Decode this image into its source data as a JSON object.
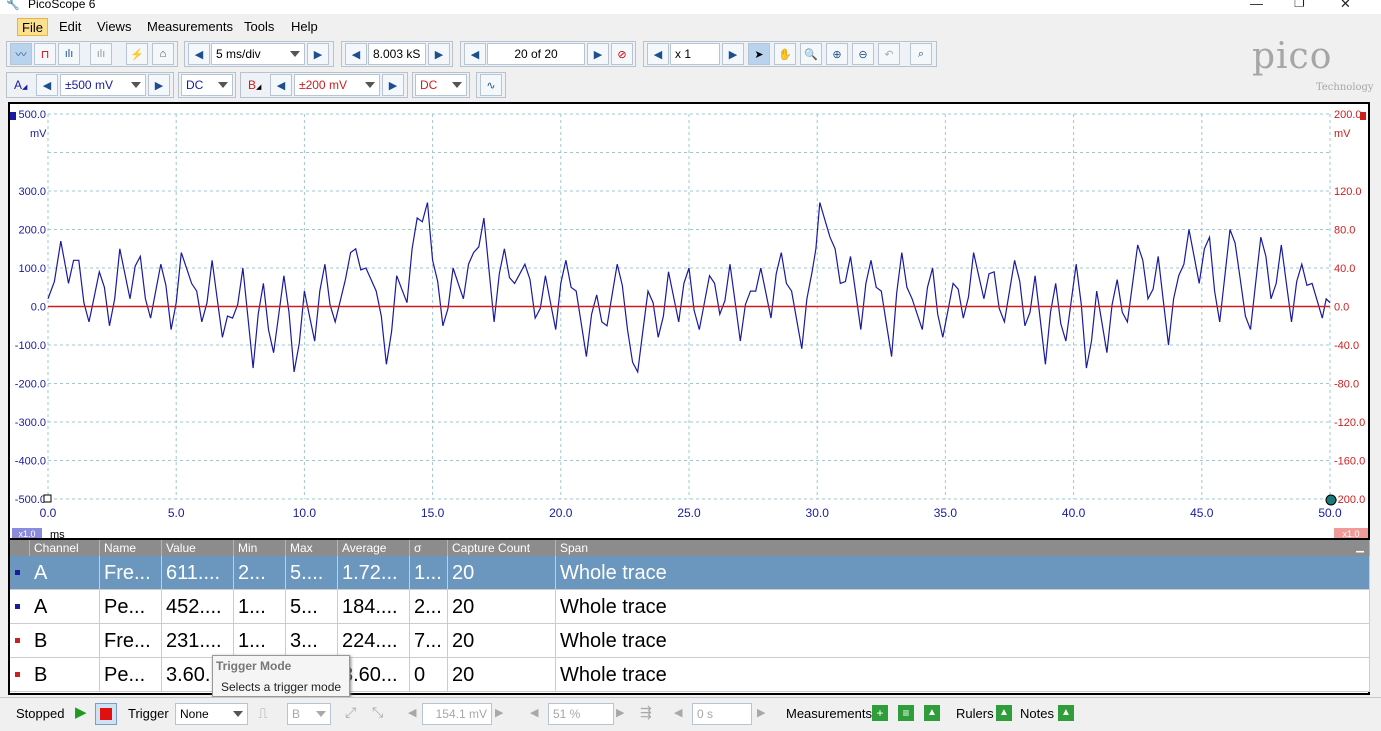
{
  "window": {
    "title": "PicoScope 6"
  },
  "menu": [
    "File",
    "Edit",
    "Views",
    "Measurements",
    "Tools",
    "Help"
  ],
  "toolbar": {
    "timebase": "5 ms/div",
    "samples": "8.003 kS",
    "buffer": "20 of 20",
    "zoom": "x 1"
  },
  "channels": {
    "a": {
      "label": "A",
      "range": "±500 mV",
      "coupling": "DC"
    },
    "b": {
      "label": "B",
      "range": "±200 mV",
      "coupling": "DC"
    }
  },
  "logo": {
    "brand": "pico",
    "sub": "Technology"
  },
  "plot": {
    "left_axis": [
      "500.0",
      "300.0",
      "200.0",
      "100.0",
      "0.0",
      "-100.0",
      "-200.0",
      "-300.0",
      "-400.0",
      "-500.0"
    ],
    "left_unit": "mV",
    "right_axis": [
      "200.0",
      "120.0",
      "80.0",
      "40.0",
      "0.0",
      "-40.0",
      "-80.0",
      "-120.0",
      "-160.0",
      "-200.0"
    ],
    "right_unit": "mV",
    "x_axis": [
      "0.0",
      "5.0",
      "10.0",
      "15.0",
      "20.0",
      "25.0",
      "30.0",
      "35.0",
      "40.0",
      "45.0",
      "50.0"
    ],
    "x_unit": "ms",
    "x_zoom_left": "x1.0",
    "x_zoom_right": "x1.0"
  },
  "chart_data": {
    "type": "line",
    "xlabel": "ms",
    "xlim": [
      0,
      50
    ],
    "series": [
      {
        "name": "A",
        "axis": "left",
        "ylim": [
          -500,
          500
        ],
        "color": "#1a1aa0",
        "x": [
          0,
          0.5,
          0.8,
          1.2,
          1.6,
          2.0,
          2.4,
          2.8,
          3.2,
          3.6,
          4.0,
          4.4,
          4.8,
          5.2,
          5.6,
          6.0,
          6.4,
          6.8,
          7.2,
          7.6,
          8.0,
          8.4,
          8.8,
          9.2,
          9.6,
          10.0,
          10.4,
          10.8,
          11.2,
          11.6,
          12.0,
          12.4,
          12.8,
          13.2,
          13.6,
          14.0,
          14.4,
          14.8,
          15.0,
          15.4,
          15.8,
          16.2,
          16.6,
          17.0,
          17.4,
          17.8,
          18.2,
          18.6,
          19.0,
          19.4,
          19.8,
          20.2,
          20.6,
          21.0,
          21.4,
          21.8,
          22.2,
          22.6,
          23.0,
          23.4,
          23.8,
          24.2,
          24.6,
          25.0,
          25.4,
          25.8,
          26.2,
          26.6,
          27.0,
          27.4,
          27.8,
          28.2,
          28.6,
          29.0,
          29.4,
          29.8,
          30.1,
          30.5,
          30.9,
          31.3,
          31.7,
          32.1,
          32.5,
          32.9,
          33.3,
          33.7,
          34.1,
          34.5,
          34.9,
          35.3,
          35.7,
          36.1,
          36.5,
          36.9,
          37.3,
          37.7,
          38.1,
          38.5,
          38.9,
          39.3,
          39.7,
          40.1,
          40.5,
          40.9,
          41.3,
          41.7,
          42.1,
          42.5,
          42.9,
          43.3,
          43.7,
          44.1,
          44.5,
          44.9,
          45.3,
          45.7,
          46.1,
          46.5,
          46.9,
          47.3,
          47.7,
          48.1,
          48.5,
          48.9,
          49.3,
          49.7,
          50.0
        ],
        "y": [
          20,
          170,
          60,
          120,
          -40,
          90,
          -50,
          150,
          20,
          130,
          -30,
          110,
          -60,
          140,
          60,
          -40,
          120,
          -80,
          -30,
          100,
          -160,
          60,
          -120,
          80,
          -170,
          40,
          -90,
          110,
          -40,
          70,
          150,
          100,
          40,
          -150,
          80,
          10,
          230,
          270,
          120,
          -50,
          100,
          20,
          140,
          230,
          -40,
          150,
          60,
          110,
          -30,
          80,
          -60,
          120,
          40,
          -130,
          30,
          -50,
          110,
          -60,
          -170,
          40,
          -80,
          90,
          -40,
          100,
          -60,
          80,
          -20,
          110,
          -90,
          40,
          100,
          -30,
          140,
          40,
          -110,
          90,
          270,
          180,
          60,
          130,
          -60,
          120,
          40,
          -130,
          140,
          20,
          -60,
          100,
          -80,
          60,
          -30,
          140,
          20,
          90,
          -40,
          120,
          -50,
          80,
          -150,
          60,
          -90,
          110,
          -160,
          40,
          -120,
          70,
          -40,
          160,
          20,
          130,
          -100,
          80,
          200,
          60,
          180,
          -40,
          200,
          70,
          -60,
          180,
          20,
          160,
          -40,
          110,
          60,
          -30,
          10
        ]
      },
      {
        "name": "B",
        "axis": "right",
        "ylim": [
          -200,
          200
        ],
        "color": "#cc1f1f",
        "x": [
          0,
          50
        ],
        "y": [
          0,
          0
        ]
      }
    ]
  },
  "measurements": {
    "headers": [
      "Channel",
      "Name",
      "Value",
      "Min",
      "Max",
      "Average",
      "σ",
      "Capture Count",
      "Span"
    ],
    "rows": [
      {
        "channel": "A",
        "name": "Fre...",
        "value": "611....",
        "min": "2...",
        "max": "5....",
        "avg": "1.72...",
        "sigma": "1...",
        "count": "20",
        "span": "Whole trace",
        "color": "#1a1aa0"
      },
      {
        "channel": "A",
        "name": "Pe...",
        "value": "452....",
        "min": "1...",
        "max": "5...",
        "avg": "184....",
        "sigma": "2...",
        "count": "20",
        "span": "Whole trace",
        "color": "#1a1aa0"
      },
      {
        "channel": "B",
        "name": "Fre...",
        "value": "231....",
        "min": "1...",
        "max": "3...",
        "avg": "224....",
        "sigma": "7...",
        "count": "20",
        "span": "Whole trace",
        "color": "#cc1f1f"
      },
      {
        "channel": "B",
        "name": "Pe...",
        "value": "3.60...",
        "min": "",
        "max": "",
        "avg": "3.60...",
        "sigma": "0",
        "count": "20",
        "span": "Whole trace",
        "color": "#cc1f1f"
      }
    ],
    "selected_row": 0
  },
  "tooltip": {
    "title": "Trigger Mode",
    "body": "Selects a trigger mode"
  },
  "status": {
    "state": "Stopped",
    "trigger_label": "Trigger",
    "trigger_mode": "None",
    "trigger_source": "B",
    "threshold": "154.1 mV",
    "pretrigger": "51 %",
    "delay": "0 s",
    "measurements_label": "Measurements",
    "rulers_label": "Rulers",
    "notes_label": "Notes"
  }
}
